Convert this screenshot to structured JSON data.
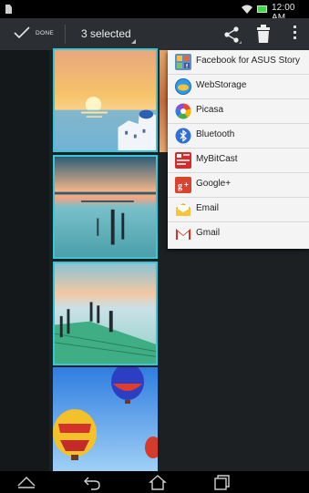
{
  "status_bar": {
    "time": "12:00 AM",
    "icons": [
      "sd-card-icon",
      "wifi-icon",
      "battery-icon"
    ],
    "battery_color": "#44d34a"
  },
  "action_bar": {
    "done_label": "DONE",
    "selection_label": "3 selected",
    "actions": [
      "share-icon",
      "trash-icon",
      "overflow-menu-icon"
    ],
    "background": "#2b2f33"
  },
  "gallery": {
    "selection_color": "#39c6d6",
    "photos": [
      {
        "subject": "sunset over coastal village",
        "selected": true
      },
      {
        "subject": "pier posts in calm lake",
        "selected": true
      },
      {
        "subject": "green wooden pier",
        "selected": true
      },
      {
        "subject": "hot air balloons",
        "selected": false
      }
    ]
  },
  "share_menu": {
    "items": [
      {
        "label": "Facebook for ASUS Story",
        "icon": "facebook-story-icon"
      },
      {
        "label": "WebStorage",
        "icon": "webstorage-icon"
      },
      {
        "label": "Picasa",
        "icon": "picasa-icon"
      },
      {
        "label": "Bluetooth",
        "icon": "bluetooth-icon"
      },
      {
        "label": "MyBitCast",
        "icon": "mybitcast-icon"
      },
      {
        "label": "Google+",
        "icon": "google-plus-icon"
      },
      {
        "label": "Email",
        "icon": "email-icon"
      },
      {
        "label": "Gmail",
        "icon": "gmail-icon"
      }
    ]
  },
  "nav_bar": {
    "buttons": [
      "collapse-icon",
      "back-icon",
      "home-icon",
      "recent-apps-icon"
    ]
  }
}
